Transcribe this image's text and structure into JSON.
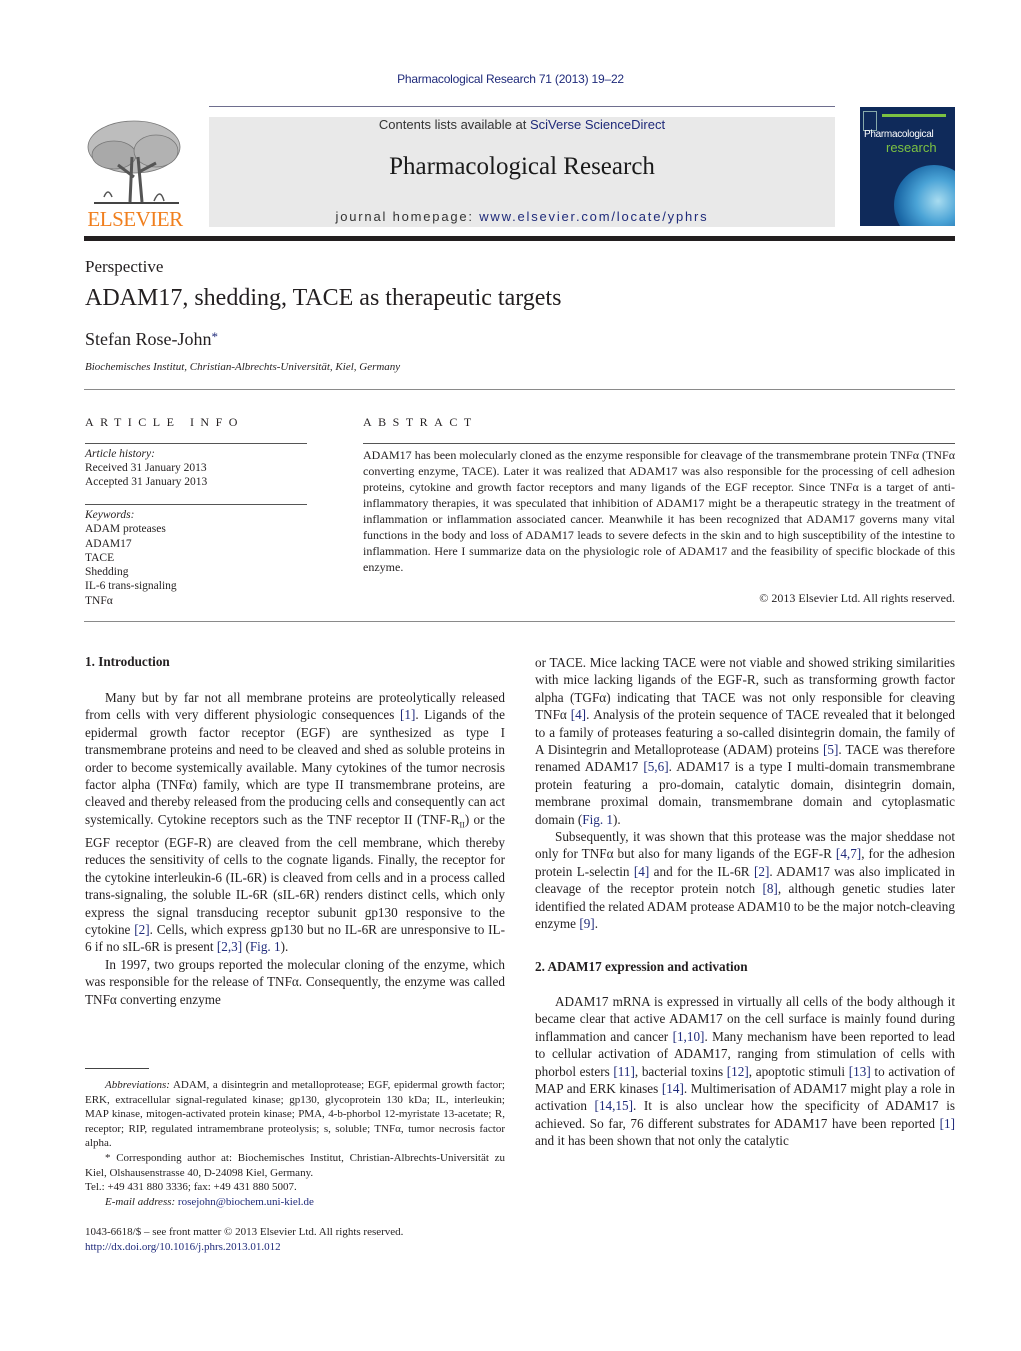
{
  "header": {
    "citation": "Pharmacological Research 71 (2013) 19–22",
    "contents_prefix": "Contents lists available at ",
    "contents_link": "SciVerse ScienceDirect",
    "journal_name": "Pharmacological Research",
    "homepage_prefix": "journal homepage: ",
    "homepage_link": "www.elsevier.com/locate/yphrs",
    "publisher_logo_text": "ELSEVIER",
    "cover_title_line1": "Pharmacological",
    "cover_title_line2": "research",
    "colors": {
      "link": "#1f2a7a",
      "publisher_orange": "#f07f1e",
      "cover_navy": "#0f2a5a",
      "cover_green": "#7cc242",
      "masthead_gray": "#e9e9e9"
    }
  },
  "article": {
    "type": "Perspective",
    "title": "ADAM17, shedding, TACE as therapeutic targets",
    "author": "Stefan Rose-John",
    "author_mark": "*",
    "affiliation": "Biochemisches Institut, Christian-Albrechts-Universität, Kiel, Germany"
  },
  "article_info": {
    "heading": "ARTICLE INFO",
    "history_label": "Article history:",
    "received": "Received 31 January 2013",
    "accepted": "Accepted 31 January 2013",
    "keywords_label": "Keywords:",
    "keywords": [
      "ADAM proteases",
      "ADAM17",
      "TACE",
      "Shedding",
      "IL-6 trans-signaling",
      "TNFα"
    ]
  },
  "abstract": {
    "heading": "ABSTRACT",
    "text": "ADAM17 has been molecularly cloned as the enzyme responsible for cleavage of the transmembrane protein TNFα (TNFα converting enzyme, TACE). Later it was realized that ADAM17 was also responsible for the processing of cell adhesion proteins, cytokine and growth factor receptors and many ligands of the EGF receptor. Since TNFα is a target of anti-inflammatory therapies, it was speculated that inhibition of ADAM17 might be a therapeutic strategy in the treatment of inflammation or inflammation associated cancer. Meanwhile it has been recognized that ADAM17 governs many vital functions in the body and loss of ADAM17 leads to severe defects in the skin and to high susceptibility of the intestine to inflammation. Here I summarize data on the physiologic role of ADAM17 and the feasibility of specific blockade of this enzyme.",
    "copyright": "© 2013 Elsevier Ltd. All rights reserved."
  },
  "sections": {
    "intro_heading": "1.  Introduction",
    "intro_p1": {
      "a": "Many but by far not all membrane proteins are proteolytically released from cells with very different physiologic consequences ",
      "ref1": "[1]",
      "b": ". Ligands of the epidermal growth factor receptor (EGF) are synthesized as type I transmembrane proteins and need to be cleaved and shed as soluble proteins in order to become systemically available. Many cytokines of the tumor necrosis factor alpha (TNFα) family, which are type II transmembrane proteins, are cleaved and thereby released from the producing cells and consequently can act systemically. Cytokine receptors such as the TNF receptor II (TNF-R",
      "sub": "II",
      "c": ") or the EGF receptor (EGF-R) are cleaved from the cell membrane, which thereby reduces the sensitivity of cells to the cognate ligands. Finally, the receptor for the cytokine interleukin-6 (IL-6R) is cleaved from cells and in a process called trans-signaling, the soluble IL-6R (sIL-6R) renders distinct cells, which only express the signal transducing receptor subunit gp130 responsive to the cytokine ",
      "ref2": "[2]",
      "d": ". Cells, which express gp130 but no IL-6R are unresponsive to IL-6 if no sIL-6R is present ",
      "ref3": "[2,3]",
      "e": " (",
      "fig": "Fig. 1",
      "f": ")."
    },
    "intro_p2": "In 1997, two groups reported the molecular cloning of the enzyme, which was responsible for the release of TNFα. Consequently, the enzyme was called TNFα converting enzyme",
    "right_p1": {
      "a": "or TACE. Mice lacking TACE were not viable and showed striking similarities with mice lacking ligands of the EGF-R, such as transforming growth factor alpha (TGFα) indicating that TACE was not only responsible for cleaving TNFα ",
      "ref4": "[4]",
      "b": ". Analysis of the protein sequence of TACE revealed that it belonged to a family of proteases featuring a so-called disintegrin domain, the family of A Disintegrin and Metalloprotease (ADAM) proteins ",
      "ref5": "[5]",
      "c": ". TACE was therefore renamed ADAM17 ",
      "ref56": "[5,6]",
      "d": ". ADAM17 is a type I multi-domain transmembrane protein featuring a pro-domain, catalytic domain, disintegrin domain, membrane proximal domain, transmembrane domain and cytoplasmatic domain (",
      "fig": "Fig. 1",
      "e": ")."
    },
    "right_p2": {
      "a": "Subsequently, it was shown that this protease was the major sheddase not only for TNFα but also for many ligands of the EGF-R ",
      "ref47": "[4,7]",
      "b": ", for the adhesion protein L-selectin ",
      "ref4": "[4]",
      "c": " and for the IL-6R ",
      "ref2": "[2]",
      "d": ". ADAM17 was also implicated in cleavage of the receptor protein notch ",
      "ref8": "[8]",
      "e": ", although genetic studies later identified the related ADAM protease ADAM10 to be the major notch-cleaving enzyme ",
      "ref9": "[9]",
      "f": "."
    },
    "section2_heading": "2.  ADAM17 expression and activation",
    "section2_p1": {
      "a": "ADAM17 mRNA is expressed in virtually all cells of the body although it became clear that active ADAM17 on the cell surface is mainly found during inflammation and cancer ",
      "ref110": "[1,10]",
      "b": ". Many mechanism have been reported to lead to cellular activation of ADAM17, ranging from stimulation of cells with phorbol esters ",
      "ref11": "[11]",
      "c": ", bacterial toxins ",
      "ref12": "[12]",
      "d": ", apoptotic stimuli ",
      "ref13": "[13]",
      "e": " to activation of MAP and ERK kinases ",
      "ref14": "[14]",
      "f": ". Multimerisation of ADAM17 might play a role in activation ",
      "ref1415": "[14,15]",
      "g": ". It is also unclear how the specificity of ADAM17 is achieved. So far, 76 different substrates for ADAM17 have been reported ",
      "ref1": "[1]",
      "h": " and it has been shown that not only the catalytic"
    }
  },
  "footnotes": {
    "abbrev_label": "Abbreviations:",
    "abbrev_text": " ADAM, a disintegrin and metalloprotease; EGF, epidermal growth factor; ERK, extracellular signal-regulated kinase; gp130, glycoprotein 130 kDa; IL, interleukin; MAP kinase, mitogen-activated protein kinase; PMA, 4-b-phorbol 12-myristate 13-acetate; R, receptor; RIP, regulated intramembrane proteolysis; s, soluble; TNFα, tumor necrosis factor alpha.",
    "corresponding": "* Corresponding author at: Biochemisches Institut, Christian-Albrechts-Universität zu Kiel, Olshausenstrasse 40, D-24098 Kiel, Germany.",
    "tel": "Tel.: +49 431 880 3336; fax: +49 431 880 5007.",
    "email_label": "E-mail address:",
    "email": "rosejohn@biochem.uni-kiel.de"
  },
  "front_matter": {
    "issn_line": "1043-6618/$ – see front matter © 2013 Elsevier Ltd. All rights reserved.",
    "doi": "http://dx.doi.org/10.1016/j.phrs.2013.01.012"
  }
}
